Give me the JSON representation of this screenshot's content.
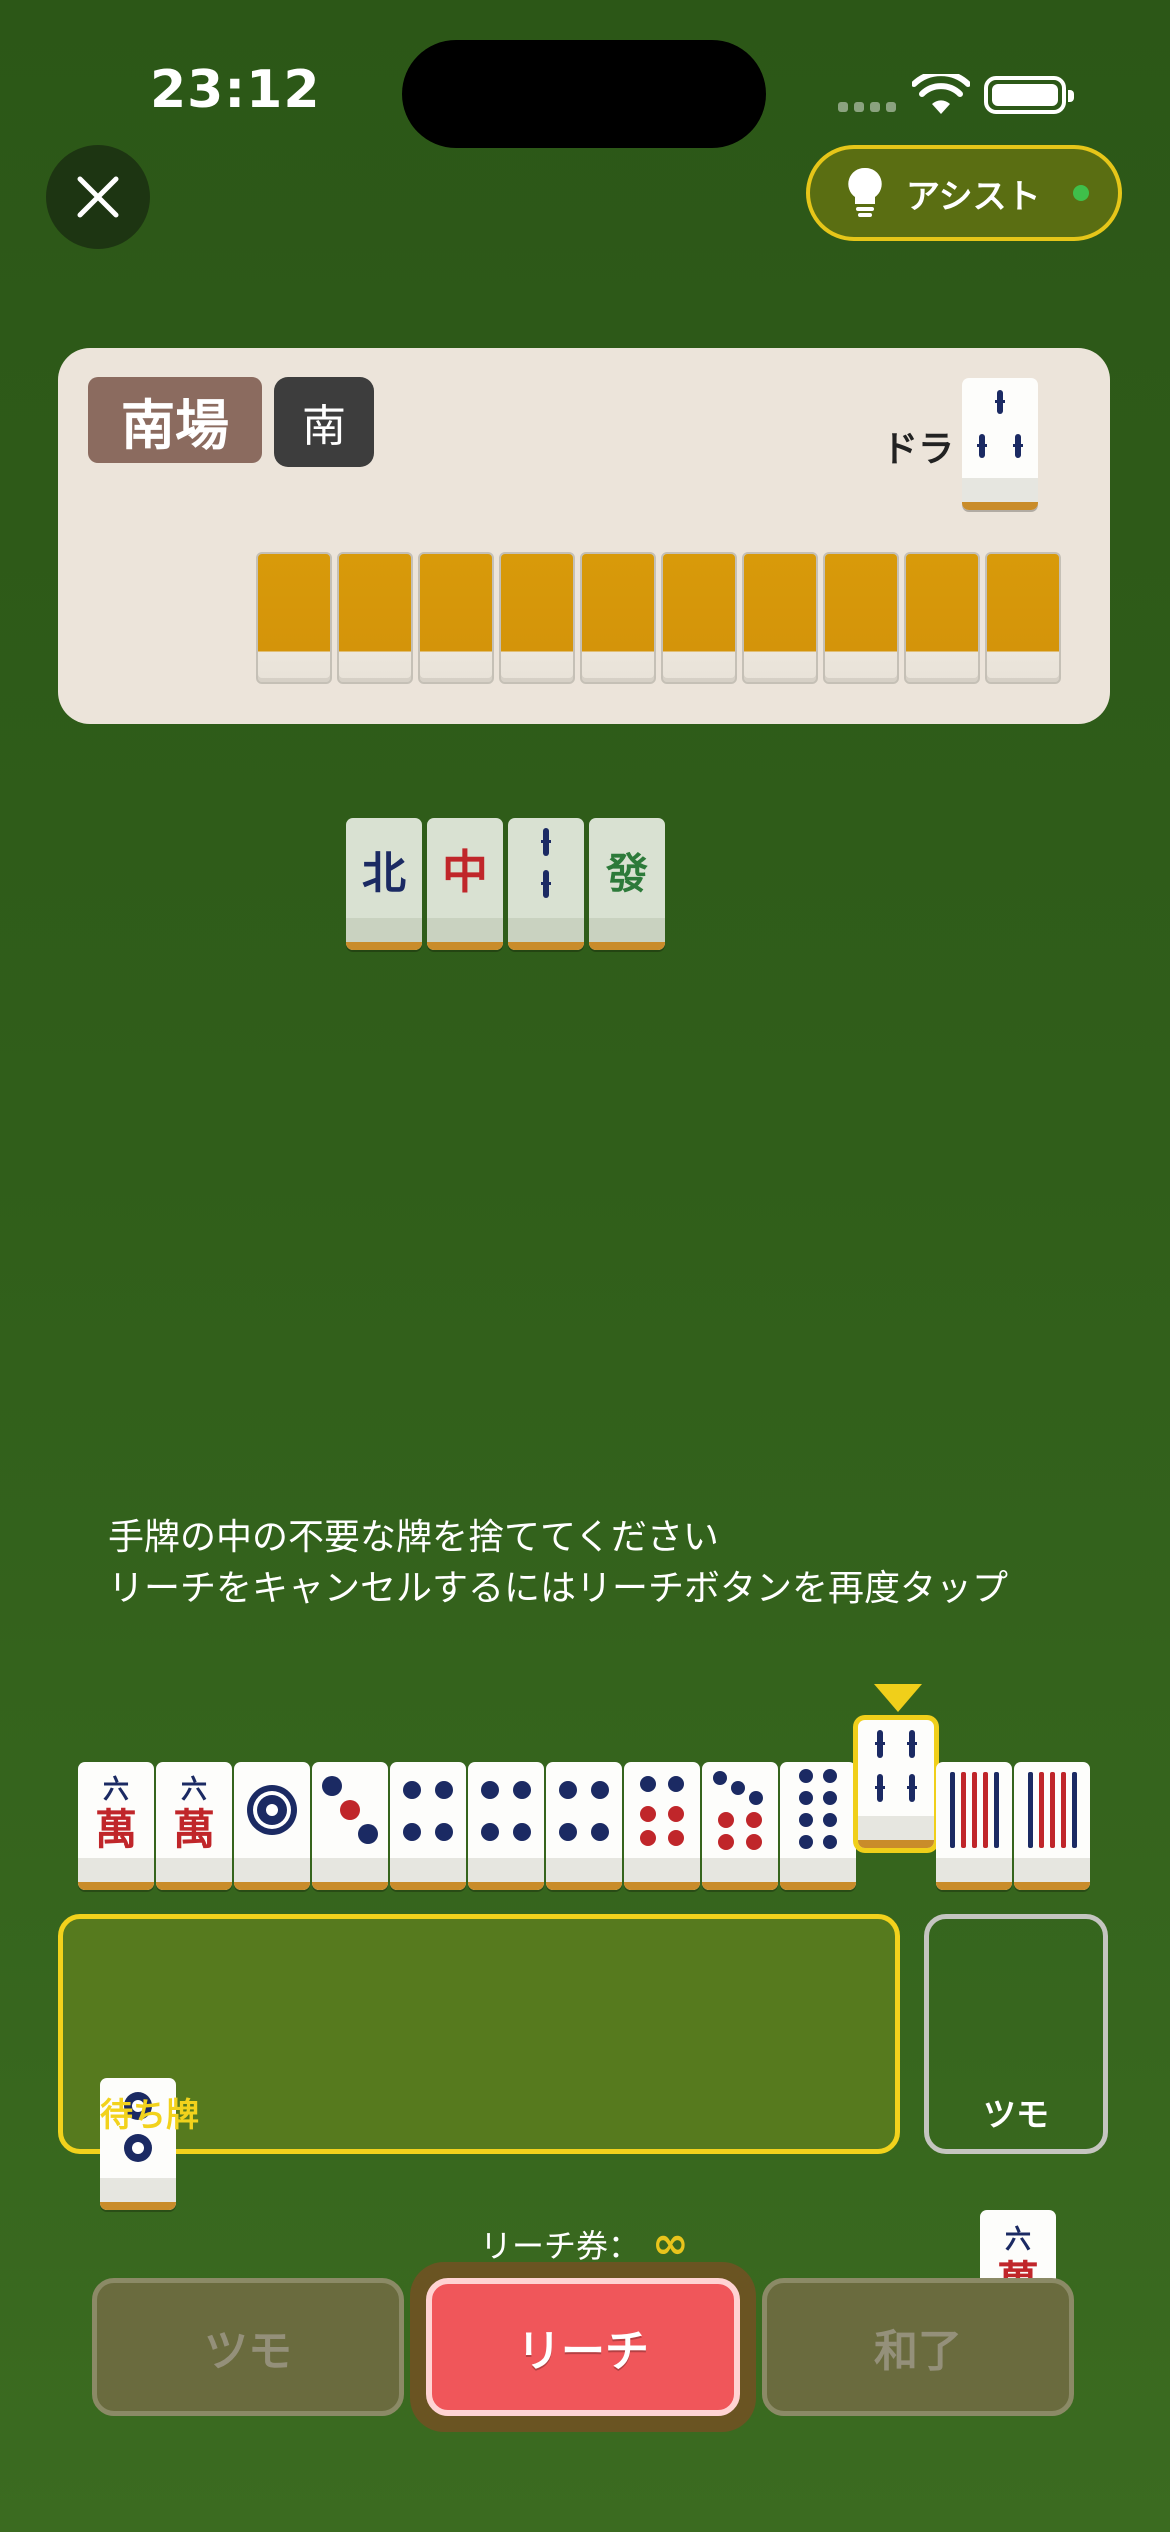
{
  "status_bar": {
    "time": "23:12"
  },
  "top_bar": {
    "close_icon": "close-icon",
    "assist_label": "アシスト",
    "assist_icon": "lightbulb-icon",
    "assist_status_color": "#3fbf4a"
  },
  "opponent": {
    "round": "南場",
    "seat_wind": "南",
    "dora_label": "ドラ",
    "dora_tile": "3-sou",
    "hidden_tile_count": 10
  },
  "discards": [
    "north",
    "red-dragon",
    "2-sou",
    "green-dragon"
  ],
  "instruction": {
    "line1": "手牌の中の不要な牌を捨ててください",
    "line2": "リーチをキャンセルするにはリーチボタンを再度タップ"
  },
  "hand": [
    "6-man",
    "6-man",
    "1-pin",
    "3-pin",
    "4-pin",
    "4-pin",
    "4-pin",
    "6-pin",
    "7-pin",
    "8-pin",
    "4-sou",
    "9-sou",
    "9-sou"
  ],
  "selected_tile": "4-sou",
  "waiting": {
    "label": "待ち牌",
    "tiles": [
      "2-pin"
    ]
  },
  "tsumo_box": {
    "label": "ツモ",
    "tile": "6-man"
  },
  "riichi_ticket": {
    "label": "リーチ券：",
    "value": "∞"
  },
  "buttons": {
    "tsumo": "ツモ",
    "riichi": "リーチ",
    "agari": "和了"
  },
  "colors": {
    "accent_yellow": "#f2d21c",
    "riichi_red": "#f0565a",
    "table_green": "#305e1a"
  }
}
